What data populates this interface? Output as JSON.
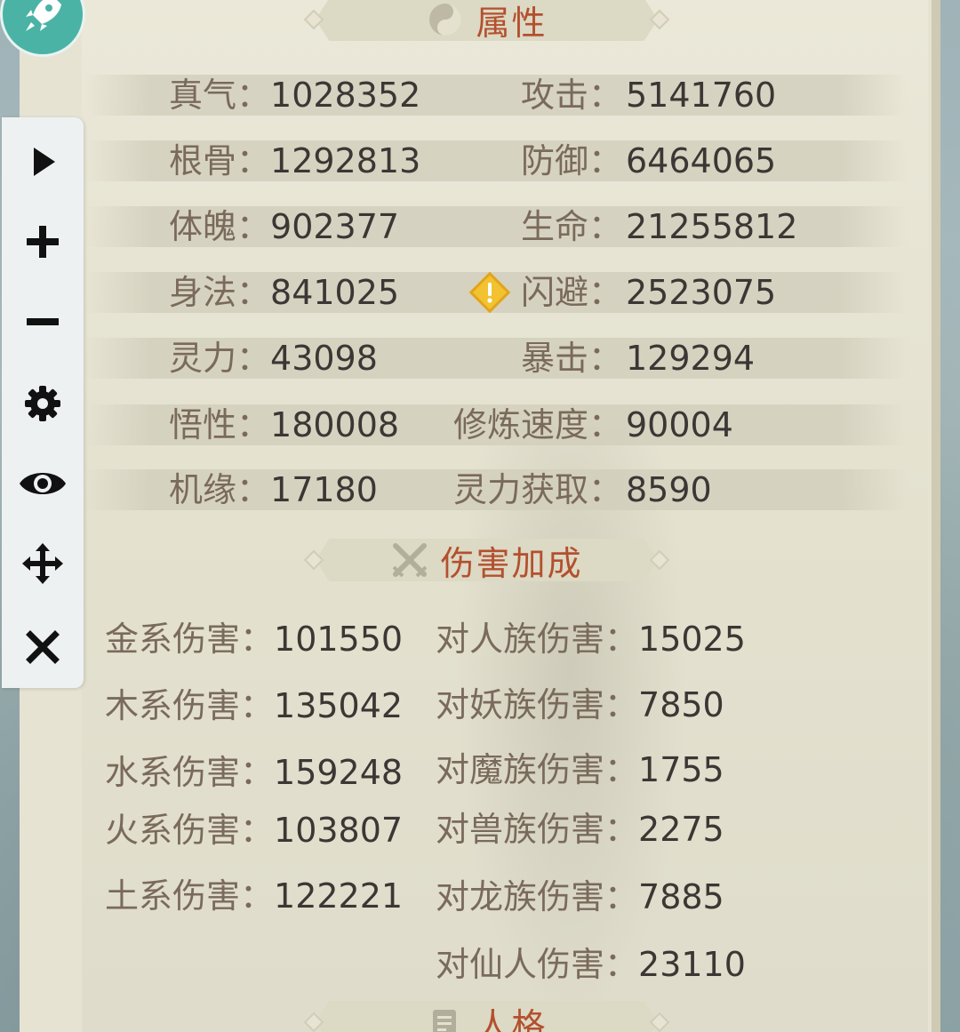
{
  "sections": {
    "attributes_title": "属性",
    "damage_title": "伤害加成",
    "personality_title": "人格"
  },
  "separator": "：",
  "attributes": {
    "left": [
      {
        "label": "真气",
        "value": "1028352"
      },
      {
        "label": "根骨",
        "value": "1292813"
      },
      {
        "label": "体魄",
        "value": "902377"
      },
      {
        "label": "身法",
        "value": "841025"
      },
      {
        "label": "灵力",
        "value": "43098"
      },
      {
        "label": "悟性",
        "value": "180008"
      },
      {
        "label": "机缘",
        "value": "17180"
      }
    ],
    "right": [
      {
        "label": "攻击",
        "value": "5141760"
      },
      {
        "label": "防御",
        "value": "6464065"
      },
      {
        "label": "生命",
        "value": "21255812"
      },
      {
        "label": "闪避",
        "value": "2523075"
      },
      {
        "label": "暴击",
        "value": "129294"
      },
      {
        "label": "修炼速度",
        "value": "90004"
      },
      {
        "label": "灵力获取",
        "value": "8590"
      }
    ]
  },
  "damage": {
    "left": [
      {
        "label": "金系伤害",
        "value": "101550"
      },
      {
        "label": "木系伤害",
        "value": "135042"
      },
      {
        "label": "水系伤害",
        "value": "159248"
      },
      {
        "label": "火系伤害",
        "value": "103807"
      },
      {
        "label": "土系伤害",
        "value": "122221"
      }
    ],
    "right": [
      {
        "label": "对人族伤害",
        "value": "15025"
      },
      {
        "label": "对妖族伤害",
        "value": "7850"
      },
      {
        "label": "对魔族伤害",
        "value": "1755"
      },
      {
        "label": "对兽族伤害",
        "value": "2275"
      },
      {
        "label": "对龙族伤害",
        "value": "7885"
      },
      {
        "label": "对仙人伤害",
        "value": "23110"
      }
    ]
  },
  "toolbar": {
    "items": [
      "play-icon",
      "plus-icon",
      "minus-icon",
      "gear-icon",
      "eye-icon",
      "move-icon",
      "close-icon"
    ]
  },
  "colors": {
    "title": "#b3502f",
    "label": "#7a6a5c",
    "value": "#3b3734",
    "panel": "#e6e3d3",
    "avatar": "#4bb3a5",
    "warning": "#f2c230"
  }
}
